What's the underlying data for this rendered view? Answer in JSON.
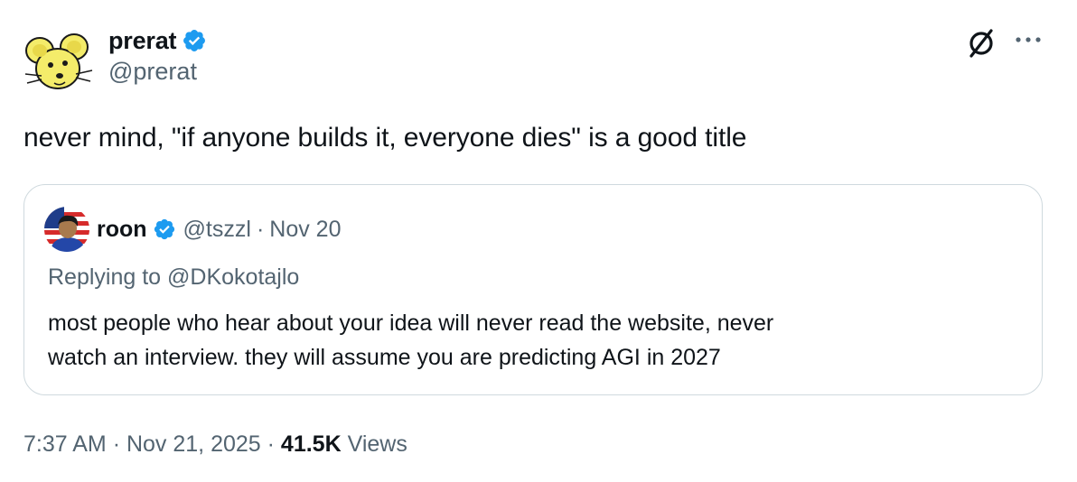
{
  "author": {
    "display_name": "prerat",
    "handle": "@prerat",
    "avatar_icon": "cartoon-mouse-avatar",
    "verified": true
  },
  "tweet": {
    "text": "never mind, \"if anyone builds it, everyone dies\" is a good title"
  },
  "quoted": {
    "display_name": "roon",
    "handle": "@tszzl",
    "separator": "·",
    "date": "Nov 20",
    "replying_prefix": "Replying to",
    "replying_to": "@DKokotajlo",
    "line1": "most people who hear about your idea will never read the website, never",
    "line2": "watch an interview. they will assume you are predicting AGI in 2027",
    "verified": true
  },
  "meta": {
    "time": "7:37 AM",
    "date": "Nov 21, 2025",
    "views_count": "41.5K",
    "views_label": "Views",
    "separator": "·"
  },
  "icons": {
    "grok": "grok-slash-circle-icon",
    "more": "more-dots-icon",
    "verified_color": "#1d9bf0"
  }
}
